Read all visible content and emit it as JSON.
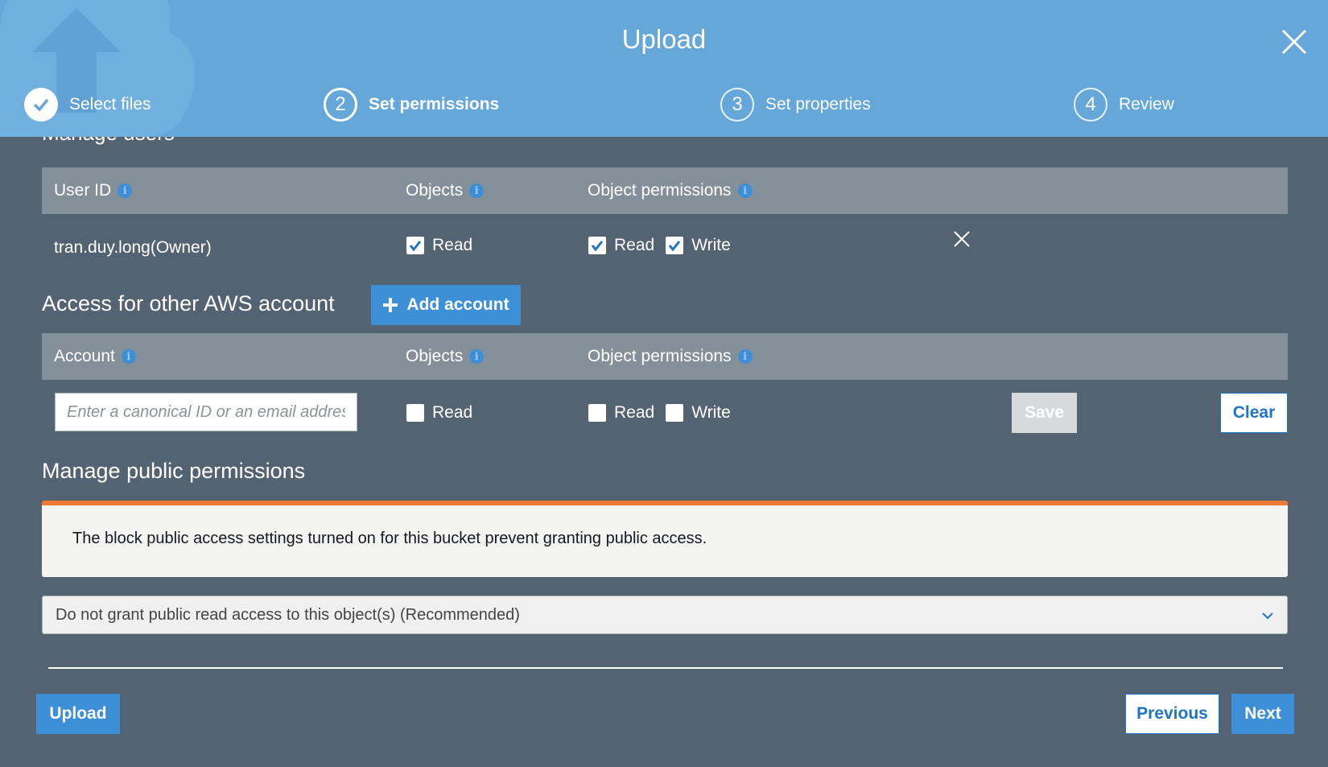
{
  "header": {
    "title": "Upload",
    "close_icon": "close-icon",
    "steps": [
      {
        "number": "1",
        "label": "Select files",
        "state": "completed"
      },
      {
        "number": "2",
        "label": "Set permissions",
        "state": "active"
      },
      {
        "number": "3",
        "label": "Set properties",
        "state": "pending"
      },
      {
        "number": "4",
        "label": "Review",
        "state": "pending"
      }
    ]
  },
  "manage_users": {
    "heading": "Manage users",
    "columns": {
      "user_id": "User ID",
      "objects": "Objects",
      "object_permissions": "Object permissions"
    },
    "row": {
      "user": "tran.duy.long(Owner)",
      "objects_read": "Read",
      "perm_read": "Read",
      "perm_write": "Write"
    }
  },
  "other_account": {
    "heading": "Access for other AWS account",
    "add_button": "Add account",
    "columns": {
      "account": "Account",
      "objects": "Objects",
      "object_permissions": "Object permissions"
    },
    "row": {
      "input_placeholder": "Enter a canonical ID or an email address",
      "objects_read": "Read",
      "perm_read": "Read",
      "perm_write": "Write",
      "save_button": "Save",
      "clear_button": "Clear"
    }
  },
  "public_permissions": {
    "heading": "Manage public permissions",
    "alert": "The block public access settings turned on for this bucket prevent granting public access.",
    "select_value": "Do not grant public read access to this object(s) (Recommended)"
  },
  "footer": {
    "upload_button": "Upload",
    "previous_button": "Previous",
    "next_button": "Next"
  },
  "colors": {
    "header_bg": "#65a7d9",
    "body_bg": "#546372",
    "table_head_bg": "#849099",
    "primary": "#3d8fd6",
    "alert_accent": "#ec7a35"
  }
}
